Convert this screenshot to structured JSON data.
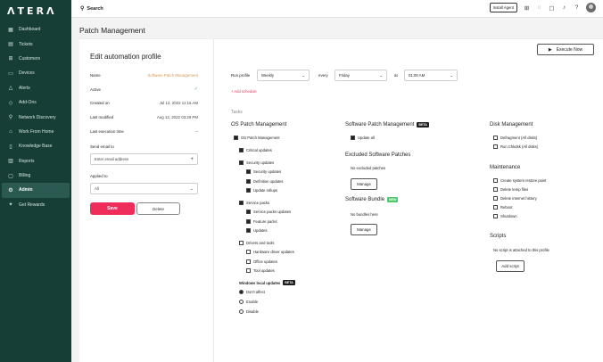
{
  "brand": {
    "logo": "ΛTERΛ"
  },
  "sidebar": {
    "items": [
      {
        "label": "Dashboard",
        "icon": "dashboard-icon",
        "glyph": "▦"
      },
      {
        "label": "Tickets",
        "icon": "ticket-icon",
        "glyph": "▤"
      },
      {
        "label": "Customers",
        "icon": "customers-icon",
        "glyph": "⊞"
      },
      {
        "label": "Devices",
        "icon": "devices-icon",
        "glyph": "▭"
      },
      {
        "label": "Alerts",
        "icon": "alert-icon",
        "glyph": "△"
      },
      {
        "label": "Add-Ons",
        "icon": "addons-icon",
        "glyph": "◇"
      },
      {
        "label": "Network Discovery",
        "icon": "network-icon",
        "glyph": "⚲"
      },
      {
        "label": "Work From Home",
        "icon": "home-icon",
        "glyph": "⌂"
      },
      {
        "label": "Knowledge Base",
        "icon": "book-icon",
        "glyph": "▯"
      },
      {
        "label": "Reports",
        "icon": "reports-icon",
        "glyph": "▥"
      },
      {
        "label": "Billing",
        "icon": "billing-icon",
        "glyph": "▢"
      },
      {
        "label": "Admin",
        "icon": "admin-icon",
        "glyph": "⚙",
        "active": true
      },
      {
        "label": "Get Rewards",
        "icon": "gift-icon",
        "glyph": "✦"
      }
    ]
  },
  "topbar": {
    "search_label": "Search",
    "install_agent": "Install Agent"
  },
  "page": {
    "title": "Patch Management"
  },
  "profile": {
    "heading": "Edit automation profile",
    "fields": {
      "name_label": "Name",
      "name_value": "Software Patch Management",
      "active_label": "Active",
      "active_value": "✓",
      "created_label": "Created on",
      "created_value": "Jul 12, 2022 11:16 AM",
      "modified_label": "Last modified",
      "modified_value": "Aug 12, 2022 03:29 PM",
      "exec_label": "Last execution time",
      "exec_value": "–"
    },
    "send_email_label": "Send email to",
    "email_placeholder": "Enter email address",
    "applied_to_label": "Applied to",
    "applied_to_value": "All",
    "save": "Save",
    "delete": "Delete"
  },
  "schedule": {
    "execute_now": "Execute Now",
    "run_profile_label": "Run profile",
    "frequency": "Weekly",
    "every_label": "every",
    "day": "Friday",
    "at_label": "at",
    "time": "01:00 AM",
    "add_schedule": "+ Add schedule"
  },
  "tasks": {
    "label": "Tasks",
    "os_patch": {
      "title": "OS Patch Management",
      "root": "OS Patch Management",
      "critical": "Critical updates",
      "security": "Security updates",
      "security_items": [
        "Security updates",
        "Definition updates",
        "Update rollups"
      ],
      "service_packs": "Service packs",
      "sp_items": [
        "Service packs updates",
        "Feature packs",
        "Updates"
      ],
      "drivers": "Drivers and tools",
      "driver_items": [
        "Hardware driver updates",
        "Office updates",
        "Tool updates"
      ],
      "wlu_title": "Windows local updates",
      "wlu_badge": "BETA",
      "wlu_options": [
        "Don't affect",
        "Enable",
        "Disable"
      ]
    },
    "software_patch": {
      "title": "Software Patch Management",
      "badge": "BETA",
      "update_all": "Update all"
    },
    "excluded": {
      "title": "Excluded Software Patches",
      "empty": "No excluded patches",
      "manage": "Manage"
    },
    "bundle": {
      "title": "Software Bundle",
      "badge": "NEW",
      "empty": "No bundles here",
      "manage": "Manage"
    },
    "disk": {
      "title": "Disk Management",
      "items": [
        "Defragment (All disks)",
        "Run Chkdsk (All disks)"
      ]
    },
    "maintenance": {
      "title": "Maintenance",
      "items": [
        "Create system restore point",
        "Delete temp files",
        "Delete internet history",
        "Reboot",
        "Shutdown"
      ]
    },
    "scripts": {
      "title": "Scripts",
      "empty": "No script is attached to this profile",
      "add": "Add script"
    }
  }
}
